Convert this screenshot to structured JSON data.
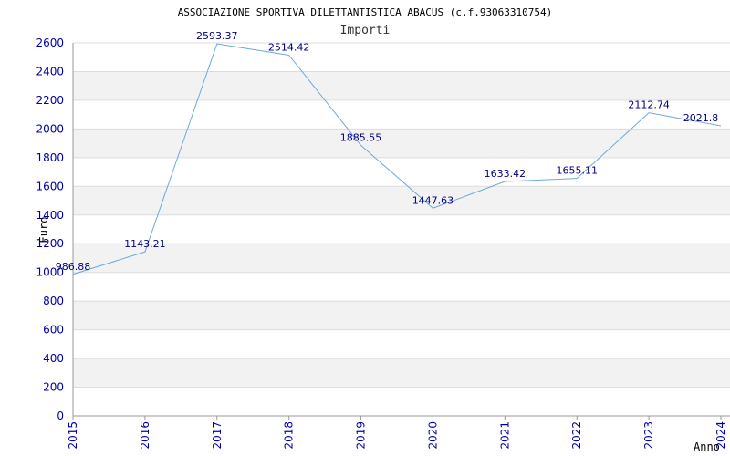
{
  "chart_data": {
    "type": "line",
    "title": "ASSOCIAZIONE SPORTIVA DILETTANTISTICA ABACUS (c.f.93063310754)",
    "subtitle": "Importi",
    "xlabel": "Anno",
    "ylabel": "Euro",
    "ylim": [
      0,
      2600
    ],
    "yticks": [
      0,
      200,
      400,
      600,
      800,
      1000,
      1200,
      1400,
      1600,
      1800,
      2000,
      2200,
      2400,
      2600
    ],
    "categories": [
      "2015",
      "2016",
      "2017",
      "2018",
      "2019",
      "2020",
      "2021",
      "2022",
      "2023",
      "2024"
    ],
    "values": [
      986.88,
      1143.21,
      2593.37,
      2514.42,
      1885.55,
      1447.63,
      1633.42,
      1655.11,
      2112.74,
      2021.8
    ],
    "data_labels": [
      "986.88",
      "1143.21",
      "2593.37",
      "2514.42",
      "1885.55",
      "1447.63",
      "1633.42",
      "1655.11",
      "2112.74",
      "2021.8"
    ],
    "grid": true,
    "colors": {
      "line": "#6fa8dc",
      "band": "#f2f2f2",
      "grid": "#dcdcdc",
      "axis_text": "#0000aa",
      "label_text": "#000080",
      "title_text": "#000000"
    }
  }
}
